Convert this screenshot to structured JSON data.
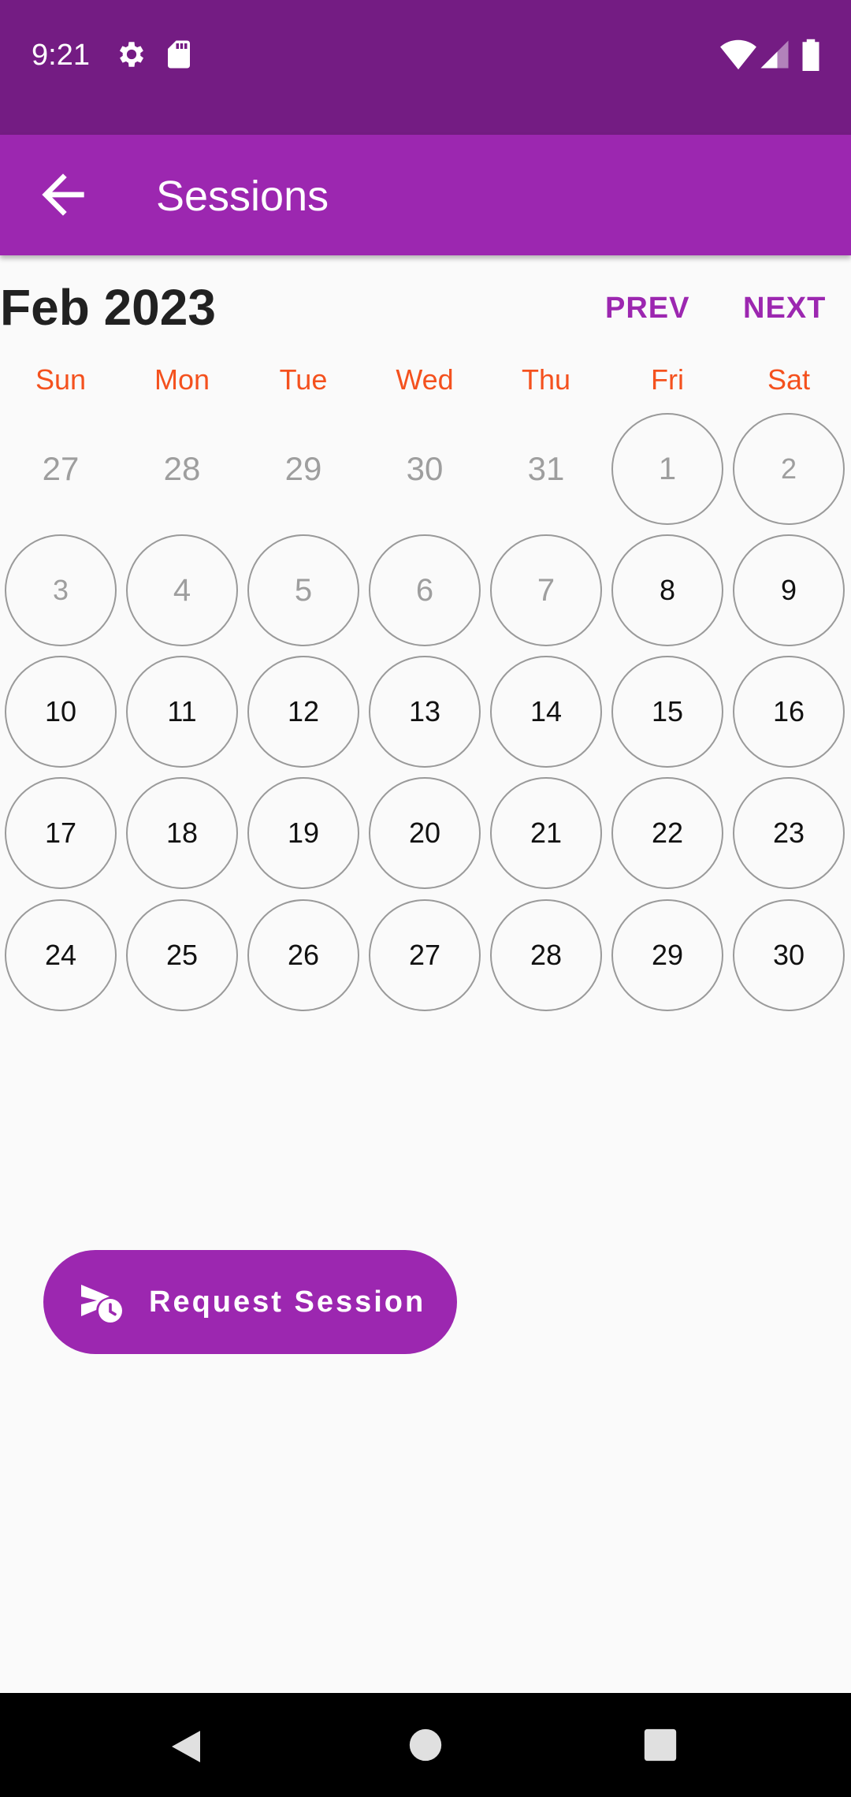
{
  "status_bar": {
    "time": "9:21",
    "icons": [
      "settings-icon",
      "sd-card-icon",
      "wifi-icon",
      "signal-icon",
      "battery-icon"
    ]
  },
  "app_bar": {
    "title": "Sessions",
    "back_icon": "arrow-back-icon"
  },
  "calendar": {
    "month_label": "Feb 2023",
    "prev_label": "PREV",
    "next_label": "NEXT",
    "weekdays": [
      "Sun",
      "Mon",
      "Tue",
      "Wed",
      "Thu",
      "Fri",
      "Sat"
    ],
    "weeks": [
      [
        {
          "label": "27"
        },
        {
          "label": "28"
        },
        {
          "label": "29"
        },
        {
          "label": "30"
        },
        {
          "label": "31"
        },
        {
          "label": "1"
        },
        {
          "label": "2"
        }
      ],
      [
        {
          "label": "3"
        },
        {
          "label": "4"
        },
        {
          "label": "5"
        },
        {
          "label": "6"
        },
        {
          "label": "7"
        },
        {
          "label": "8"
        },
        {
          "label": "9"
        }
      ],
      [
        {
          "label": "10"
        },
        {
          "label": "11"
        },
        {
          "label": "12"
        },
        {
          "label": "13"
        },
        {
          "label": "14"
        },
        {
          "label": "15"
        },
        {
          "label": "16"
        }
      ],
      [
        {
          "label": "17"
        },
        {
          "label": "18"
        },
        {
          "label": "19"
        },
        {
          "label": "20"
        },
        {
          "label": "21"
        },
        {
          "label": "22"
        },
        {
          "label": "23"
        }
      ],
      [
        {
          "label": "24"
        },
        {
          "label": "25"
        },
        {
          "label": "26"
        },
        {
          "label": "27"
        },
        {
          "label": "28"
        },
        {
          "label": "29"
        },
        {
          "label": "30"
        }
      ]
    ]
  },
  "request_button": {
    "label": "Request Session",
    "icon": "schedule-send-icon"
  },
  "navigation_bar": {
    "icons": [
      "back-triangle-icon",
      "home-circle-icon",
      "recents-square-icon"
    ]
  },
  "colors": {
    "status_bar": "#741c83",
    "app_bar": "#9c27b0",
    "accent": "#9c27b0",
    "weekday": "#f4511e",
    "background": "#fafafa"
  }
}
